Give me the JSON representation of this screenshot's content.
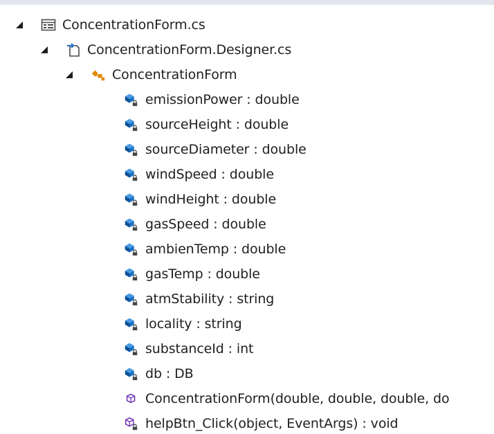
{
  "tree": {
    "file": {
      "label": "ConcentrationForm.cs",
      "expander": "expanded",
      "icon": "form-file-icon"
    },
    "designer": {
      "label": "ConcentrationForm.Designer.cs",
      "expander": "expanded",
      "icon": "designer-file-icon"
    },
    "class": {
      "label": "ConcentrationForm",
      "expander": "expanded",
      "icon": "class-icon"
    },
    "members": [
      {
        "label": "emissionPower : double",
        "icon": "private-field-icon"
      },
      {
        "label": "sourceHeight : double",
        "icon": "private-field-icon"
      },
      {
        "label": "sourceDiameter : double",
        "icon": "private-field-icon"
      },
      {
        "label": "windSpeed : double",
        "icon": "private-field-icon"
      },
      {
        "label": "windHeight : double",
        "icon": "private-field-icon"
      },
      {
        "label": "gasSpeed : double",
        "icon": "private-field-icon"
      },
      {
        "label": "ambienTemp : double",
        "icon": "private-field-icon"
      },
      {
        "label": "gasTemp : double",
        "icon": "private-field-icon"
      },
      {
        "label": "atmStability : string",
        "icon": "private-field-icon"
      },
      {
        "label": "locality : string",
        "icon": "private-field-icon"
      },
      {
        "label": "substanceId : int",
        "icon": "private-field-icon"
      },
      {
        "label": "db : DB",
        "icon": "private-field-icon"
      },
      {
        "label": "ConcentrationForm(double, double, double, do",
        "icon": "method-icon"
      },
      {
        "label": "helpBtn_Click(object, EventArgs) : void",
        "icon": "private-method-icon"
      }
    ]
  },
  "colors": {
    "expander": "#1e1e1e",
    "field": "#1a6fc4",
    "field_dark": "#0e4f93",
    "lock": "#444444",
    "method": "#6b2fb3",
    "class_accent": "#e08a00",
    "file_border": "#4a4a4a"
  }
}
